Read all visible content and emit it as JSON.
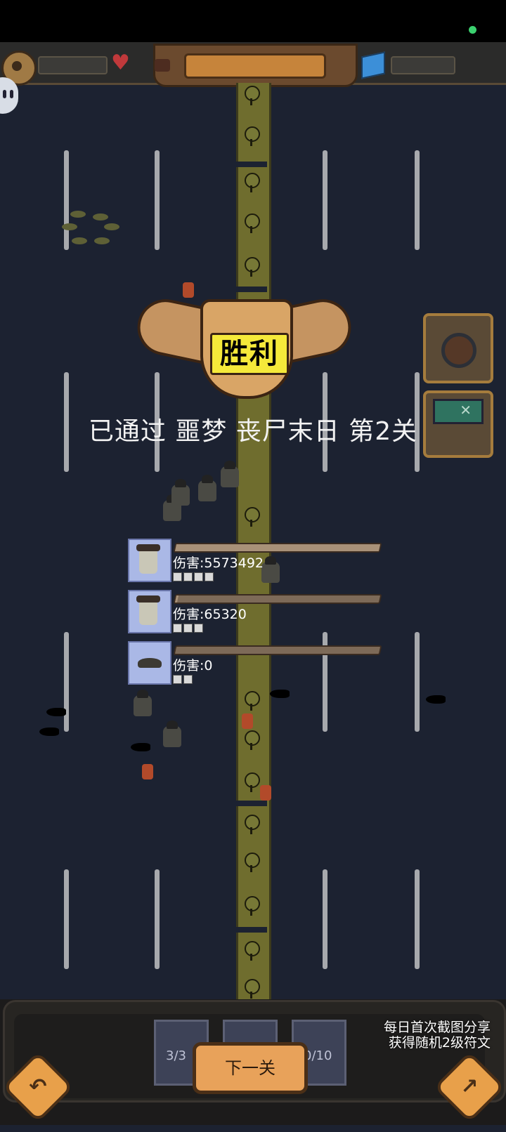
{
  "result": {
    "title": "胜利",
    "stage_text": "已通过 噩梦 丧尸末日 第2关"
  },
  "damage_stats": [
    {
      "label": "伤害:5573492",
      "bar_fraction": 1.0
    },
    {
      "label": "伤害:65320",
      "bar_fraction": 0.012
    },
    {
      "label": "伤害:0",
      "bar_fraction": 0.0
    }
  ],
  "bottom": {
    "slots": [
      "3/3",
      "",
      "0/10"
    ],
    "next_button": "下一关",
    "share_tip_line1": "每日首次截图分享",
    "share_tip_line2": "获得随机2级符文"
  },
  "icons": {
    "settings": "gear-icon",
    "health": "heart-icon",
    "resource": "cube-icon",
    "back": "back-arrow-icon",
    "share": "share-icon"
  },
  "colors": {
    "background": "#1c2231",
    "victory_text_bg": "#f5e93a",
    "button_orange": "#e8a25a"
  }
}
